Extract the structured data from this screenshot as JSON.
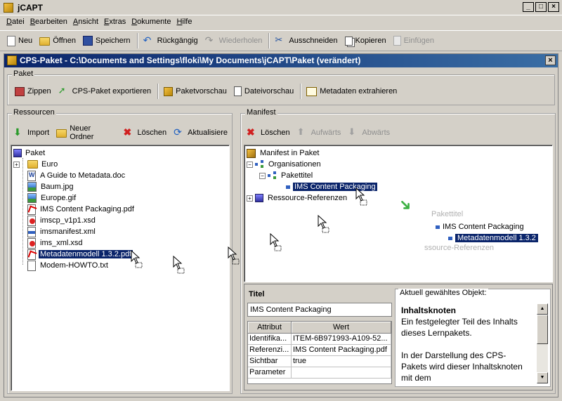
{
  "window": {
    "title": "jCAPT"
  },
  "menu": [
    "Datei",
    "Bearbeiten",
    "Ansicht",
    "Extras",
    "Dokumente",
    "Hilfe"
  ],
  "toolbar": {
    "new": "Neu",
    "open": "Öffnen",
    "save": "Speichern",
    "undo": "Rückgängig",
    "redo": "Wiederholen",
    "cut": "Ausschneiden",
    "copy": "Kopieren",
    "paste": "Einfügen"
  },
  "doc_frame": {
    "title": "CPS-Paket - C:\\Documents and Settings\\floki\\My Documents\\jCAPT\\Paket  (verändert)"
  },
  "paket_group": {
    "legend": "Paket",
    "buttons": [
      "Zippen",
      "CPS-Paket exportieren",
      "Paketvorschau",
      "Dateivorschau",
      "Metadaten extrahieren"
    ]
  },
  "resources": {
    "legend": "Ressourcen",
    "buttons": [
      "Import",
      "Neuer Ordner",
      "Löschen",
      "Aktualisiere"
    ],
    "root": "Paket",
    "items": [
      {
        "label": "Euro",
        "icon": "folder-icon"
      },
      {
        "label": "A Guide to Metadata.doc",
        "icon": "word-doc-icon"
      },
      {
        "label": "Baum.jpg",
        "icon": "image-icon"
      },
      {
        "label": "Europe.gif",
        "icon": "image-icon"
      },
      {
        "label": "IMS Content Packaging.pdf",
        "icon": "pdf-icon"
      },
      {
        "label": "imscp_v1p1.xsd",
        "icon": "xsd-icon"
      },
      {
        "label": "imsmanifest.xml",
        "icon": "xml-icon"
      },
      {
        "label": "ims_xml.xsd",
        "icon": "xsd-icon"
      },
      {
        "label": "Metadatenmodell 1.3.2.pdf",
        "icon": "pdf-icon"
      },
      {
        "label": "Modem-HOWTO.txt",
        "icon": "text-file-icon"
      }
    ]
  },
  "manifest": {
    "legend": "Manifest",
    "buttons": [
      "Löschen",
      "Aufwärts",
      "Abwärts"
    ],
    "root": "Manifest in Paket",
    "organisations": "Organisationen",
    "pakettitel": "Pakettitel",
    "selected_item": "IMS Content Packaging",
    "resource_refs": "Ressource-Referenzen",
    "ghost": {
      "line1": "Pakettitel",
      "line2": "IMS Content Packaging",
      "line3": "Metadatenmodell 1.3.2",
      "line4": "ssource-Referenzen"
    }
  },
  "properties": {
    "title_label": "Titel",
    "title_value": "IMS Content Packaging",
    "columns": [
      "Attribut",
      "Wert"
    ],
    "rows": [
      [
        "Identifika...",
        "ITEM-6B971993-A109-52..."
      ],
      [
        "Referenzi...",
        "IMS Content Packaging.pdf"
      ],
      [
        "Sichtbar",
        "true"
      ],
      [
        "Parameter",
        ""
      ]
    ]
  },
  "info": {
    "legend": "Aktuell gewähltes Objekt:",
    "heading": "Inhaltsknoten",
    "para1": "Ein festgelegter Teil des Inhalts dieses Lernpakets.",
    "para2": "In der Darstellung des CPS-Pakets wird dieser Inhaltsknoten mit dem"
  }
}
